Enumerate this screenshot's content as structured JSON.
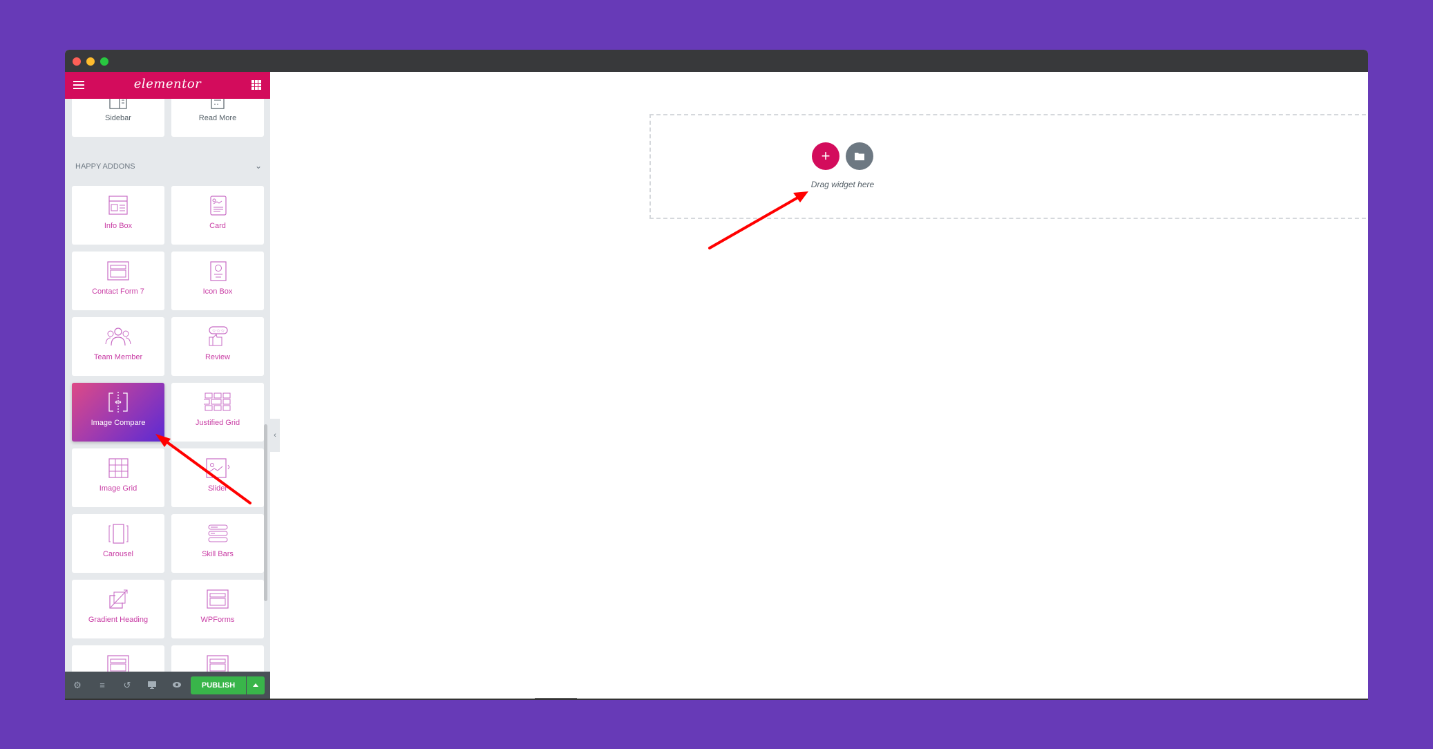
{
  "window": {
    "traffic_lights": [
      {
        "name": "close",
        "color": "#fe5f57"
      },
      {
        "name": "minimize",
        "color": "#febc2e"
      },
      {
        "name": "maximize",
        "color": "#28c840"
      }
    ]
  },
  "sidebar": {
    "logo": "elementor",
    "menu_icon": "hamburger-icon",
    "widgets_icon": "grid-icon",
    "top_widgets": [
      {
        "label": "Sidebar",
        "icon": "sidebar-icon"
      },
      {
        "label": "Read More",
        "icon": "read-more-icon"
      }
    ],
    "section_title": "HAPPY ADDONS",
    "widgets": [
      {
        "label": "Info Box",
        "icon": "info-box-icon"
      },
      {
        "label": "Card",
        "icon": "card-icon"
      },
      {
        "label": "Contact Form 7",
        "icon": "contact-form-icon"
      },
      {
        "label": "Icon Box",
        "icon": "icon-box-icon"
      },
      {
        "label": "Team Member",
        "icon": "team-member-icon"
      },
      {
        "label": "Review",
        "icon": "review-icon"
      },
      {
        "label": "Image Compare",
        "icon": "image-compare-icon",
        "active": true
      },
      {
        "label": "Justified Grid",
        "icon": "justified-grid-icon"
      },
      {
        "label": "Image Grid",
        "icon": "image-grid-icon"
      },
      {
        "label": "Slider",
        "icon": "slider-icon"
      },
      {
        "label": "Carousel",
        "icon": "carousel-icon"
      },
      {
        "label": "Skill Bars",
        "icon": "skill-bars-icon"
      },
      {
        "label": "Gradient Heading",
        "icon": "gradient-heading-icon"
      },
      {
        "label": "WPForms",
        "icon": "wpforms-icon"
      }
    ],
    "footer": {
      "icons": [
        "settings-icon",
        "navigator-icon",
        "history-icon",
        "responsive-icon",
        "preview-icon"
      ],
      "publish_label": "PUBLISH"
    }
  },
  "canvas": {
    "drop_text": "Drag widget here",
    "add_button_label": "+"
  },
  "colors": {
    "background": "#673ab7",
    "brand": "#d30c5c",
    "publish": "#39b54a",
    "annotation_arrow": "#ff0000"
  }
}
